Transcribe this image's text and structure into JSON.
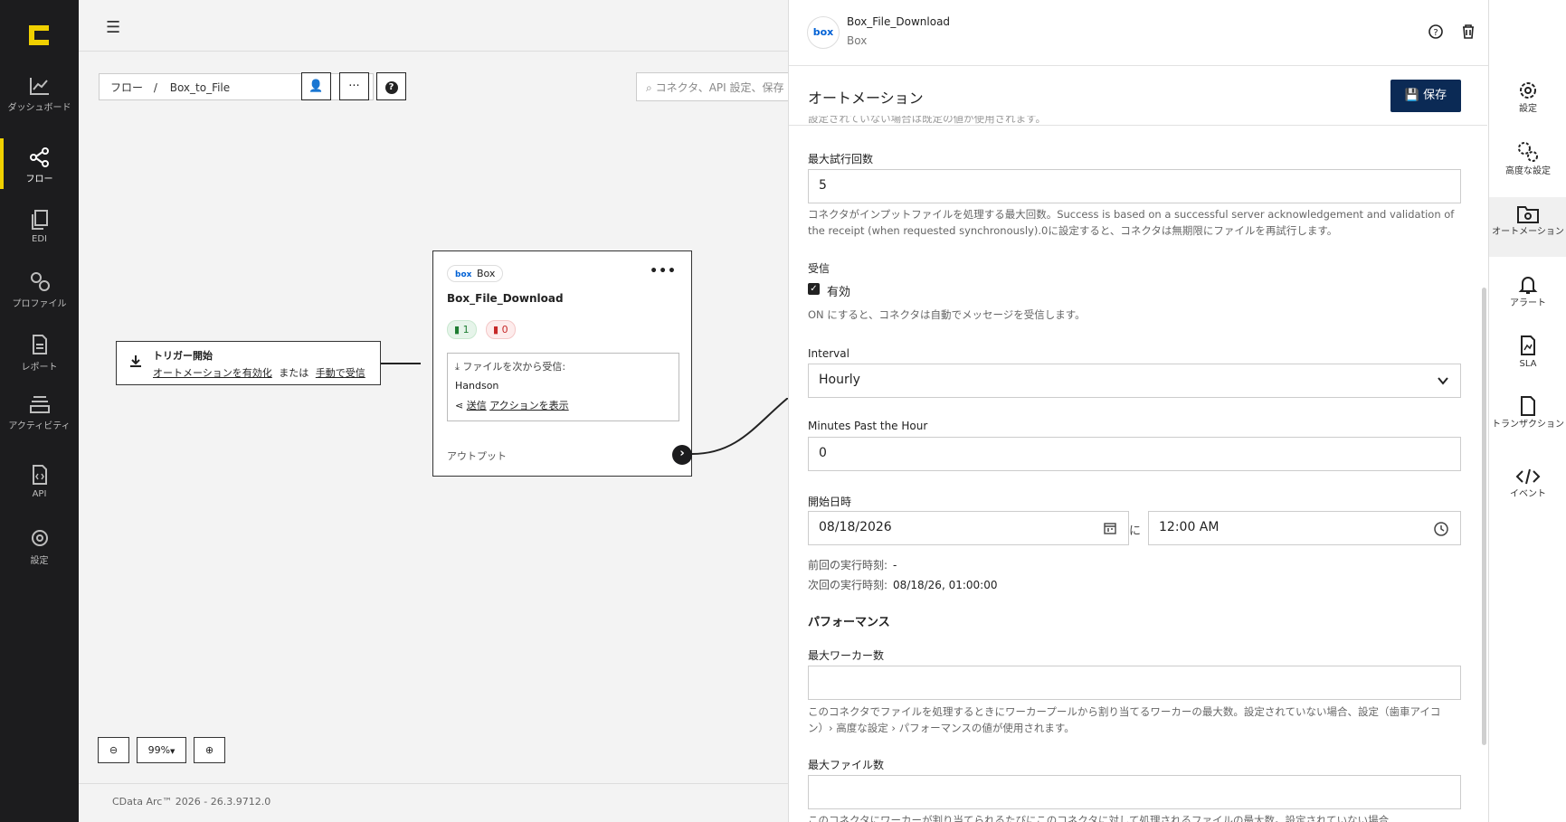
{
  "leftnav": {
    "items": [
      {
        "label": "ダッシュボード",
        "icon": "chart-icon"
      },
      {
        "label": "フロー",
        "icon": "flow-icon",
        "active": true
      },
      {
        "label": "EDI",
        "icon": "edi-icon"
      },
      {
        "label": "プロファイル",
        "icon": "profile-gears-icon"
      },
      {
        "label": "レポート",
        "icon": "report-icon"
      },
      {
        "label": "アクティビティ",
        "icon": "activity-icon"
      },
      {
        "label": "API",
        "icon": "api-icon"
      },
      {
        "label": "設定",
        "icon": "gear-icon"
      }
    ]
  },
  "canvas": {
    "breadcrumb_root": "フロー",
    "breadcrumb_sep": "/",
    "flow_name": "Box_to_File",
    "search_placeholder": "コネクタ、API 設定、保存",
    "trigger": {
      "title": "トリガー開始",
      "link1": "オートメーションを有効化",
      "or": "または",
      "link2": "手動で受信"
    },
    "node": {
      "provider": "Box",
      "provider_logo": "box",
      "name": "Box_File_Download",
      "success_count": "1",
      "error_count": "0",
      "receive_label": "ファイルを次から受信:",
      "receive_source": "Handson",
      "send_link_a": "送信",
      "send_link_b": "アクションを表示",
      "output_label": "アウトプット"
    },
    "zoom_level": "99%",
    "version": "CData Arc™ 2026 - 26.3.9712.0"
  },
  "panel": {
    "title": "Box_File_Download",
    "subtitle": "Box",
    "logo_text": "box",
    "section_title": "オートメーション",
    "save_label": "保存",
    "clipped_text": "設定されていない場合は既定の値が使用されます。",
    "max_attempts_label": "最大試行回数",
    "max_attempts_value": "5",
    "max_attempts_help": "コネクタがインプットファイルを処理する最大回数。Success is based on a successful server acknowledgement and validation of the receipt (when requested synchronously).0に設定すると、コネクタは無期限にファイルを再試行します。",
    "receive_label": "受信",
    "receive_enabled_label": "有効",
    "receive_help": "ON にすると、コネクタは自動でメッセージを受信します。",
    "interval_label": "Interval",
    "interval_value": "Hourly",
    "minutes_label": "Minutes Past the Hour",
    "minutes_value": "0",
    "start_label": "開始日時",
    "start_date": "08/18/2026",
    "start_at": "に",
    "start_time": "12:00 AM",
    "last_run_label": "前回の実行時刻:",
    "last_run_value": "-",
    "next_run_label": "次回の実行時刻:",
    "next_run_value": "08/18/26, 01:00:00",
    "performance_label": "パフォーマンス",
    "max_workers_label": "最大ワーカー数",
    "max_workers_value": "",
    "max_workers_help": "このコネクタでファイルを処理するときにワーカープールから割り当てるワーカーの最大数。設定されていない場合、設定（歯車アイコン）› 高度な設定 › パフォーマンスの値が使用されます。",
    "max_files_label": "最大ファイル数",
    "max_files_value": "",
    "max_files_help": "このコネクタにワーカーが割り当てられるたびにこのコネクタに対して処理されるファイルの最大数。設定されていない場合"
  },
  "rtabs": [
    {
      "label": "設定",
      "icon": "gear-icon"
    },
    {
      "label": "高度な設定",
      "icon": "gears-icon"
    },
    {
      "label": "オートメーション",
      "icon": "automation-folder-icon",
      "active": true
    },
    {
      "label": "アラート",
      "icon": "bell-icon"
    },
    {
      "label": "SLA",
      "icon": "sla-icon"
    },
    {
      "label": "トランザクション",
      "icon": "transaction-icon"
    },
    {
      "label": "イベント",
      "icon": "code-icon"
    }
  ],
  "colors": {
    "nav_bg": "#1c1c1e",
    "accent": "#f0d000",
    "save_button": "#0b2a55",
    "box_blue": "#0061d5"
  }
}
